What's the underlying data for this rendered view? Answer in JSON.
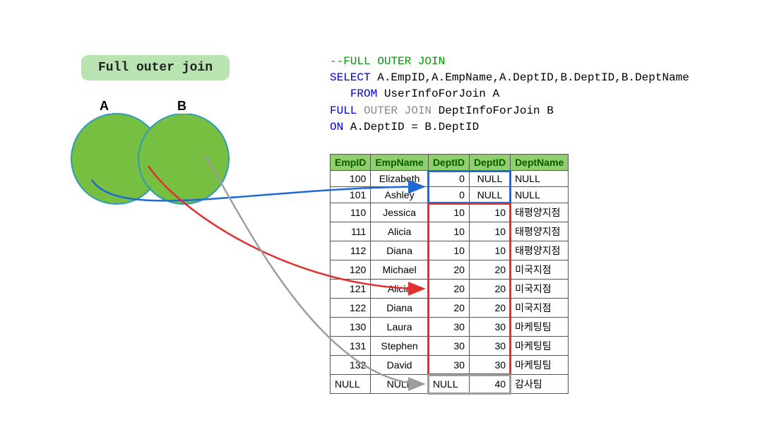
{
  "title": "Full outer join",
  "venn": {
    "labelA": "A",
    "labelB": "B"
  },
  "code": {
    "l1_comment": "--FULL OUTER JOIN",
    "l2_select": "SELECT",
    "l2_cols": " A.EmpID,A.EmpName,A.DeptID,B.DeptID,B.DeptName",
    "l3_from": "FROM",
    "l3_tableA": " UserInfoForJoin A",
    "l4_full": "FULL",
    "l4_outer": " OUTER",
    "l4_join": " JOIN",
    "l4_tableB": " DeptInfoForJoin B",
    "l5_on": "ON",
    "l5_cond": " A.DeptID = B.DeptID"
  },
  "columns": [
    "EmpID",
    "EmpName",
    "DeptID",
    "DeptID",
    "DeptName"
  ],
  "rows": [
    {
      "EmpID": "100",
      "EmpName": "Elizabeth",
      "ADeptID": "0",
      "BDeptID": "NULL",
      "DeptName": "NULL"
    },
    {
      "EmpID": "101",
      "EmpName": "Ashley",
      "ADeptID": "0",
      "BDeptID": "NULL",
      "DeptName": "NULL"
    },
    {
      "EmpID": "110",
      "EmpName": "Jessica",
      "ADeptID": "10",
      "BDeptID": "10",
      "DeptName": "태평양지점"
    },
    {
      "EmpID": "111",
      "EmpName": "Alicia",
      "ADeptID": "10",
      "BDeptID": "10",
      "DeptName": "태평양지점"
    },
    {
      "EmpID": "112",
      "EmpName": "Diana",
      "ADeptID": "10",
      "BDeptID": "10",
      "DeptName": "태평양지점"
    },
    {
      "EmpID": "120",
      "EmpName": "Michael",
      "ADeptID": "20",
      "BDeptID": "20",
      "DeptName": "미국지점"
    },
    {
      "EmpID": "121",
      "EmpName": "Alicia",
      "ADeptID": "20",
      "BDeptID": "20",
      "DeptName": "미국지점"
    },
    {
      "EmpID": "122",
      "EmpName": "Diana",
      "ADeptID": "20",
      "BDeptID": "20",
      "DeptName": "미국지점"
    },
    {
      "EmpID": "130",
      "EmpName": "Laura",
      "ADeptID": "30",
      "BDeptID": "30",
      "DeptName": "마케팅팀"
    },
    {
      "EmpID": "131",
      "EmpName": "Stephen",
      "ADeptID": "30",
      "BDeptID": "30",
      "DeptName": "마케팅팀"
    },
    {
      "EmpID": "132",
      "EmpName": "David",
      "ADeptID": "30",
      "BDeptID": "30",
      "DeptName": "마케팅팀"
    },
    {
      "EmpID": "NULL",
      "EmpName": "NULL",
      "ADeptID": "NULL",
      "BDeptID": "40",
      "DeptName": "감사팀"
    }
  ],
  "highlight": {
    "blue": {
      "rows": [
        0,
        1
      ],
      "cols": [
        2,
        3
      ],
      "note": "A-only (left outer rows)"
    },
    "red": {
      "rows": [
        2,
        3,
        4,
        5,
        6,
        7,
        8,
        9,
        10
      ],
      "cols": [
        2,
        3
      ],
      "note": "matched inner-join rows"
    },
    "gray": {
      "rows": [
        11
      ],
      "cols": [
        2,
        3
      ],
      "note": "B-only (right outer row)"
    }
  },
  "arrows": {
    "blue_note": "from A-only region → blue box",
    "red_note": "from A∩B region → red box",
    "gray_note": "from B-only region → gray box"
  },
  "colors": {
    "pill_bg": "#b9e3b0",
    "circle_fill": "#76bf41",
    "circle_border": "#2e9bbd",
    "table_header_bg": "#8fd06c",
    "table_header_fg": "#0a5a00",
    "blue": "#1f6ad4",
    "red": "#e03030",
    "gray": "#9d9d9d"
  }
}
